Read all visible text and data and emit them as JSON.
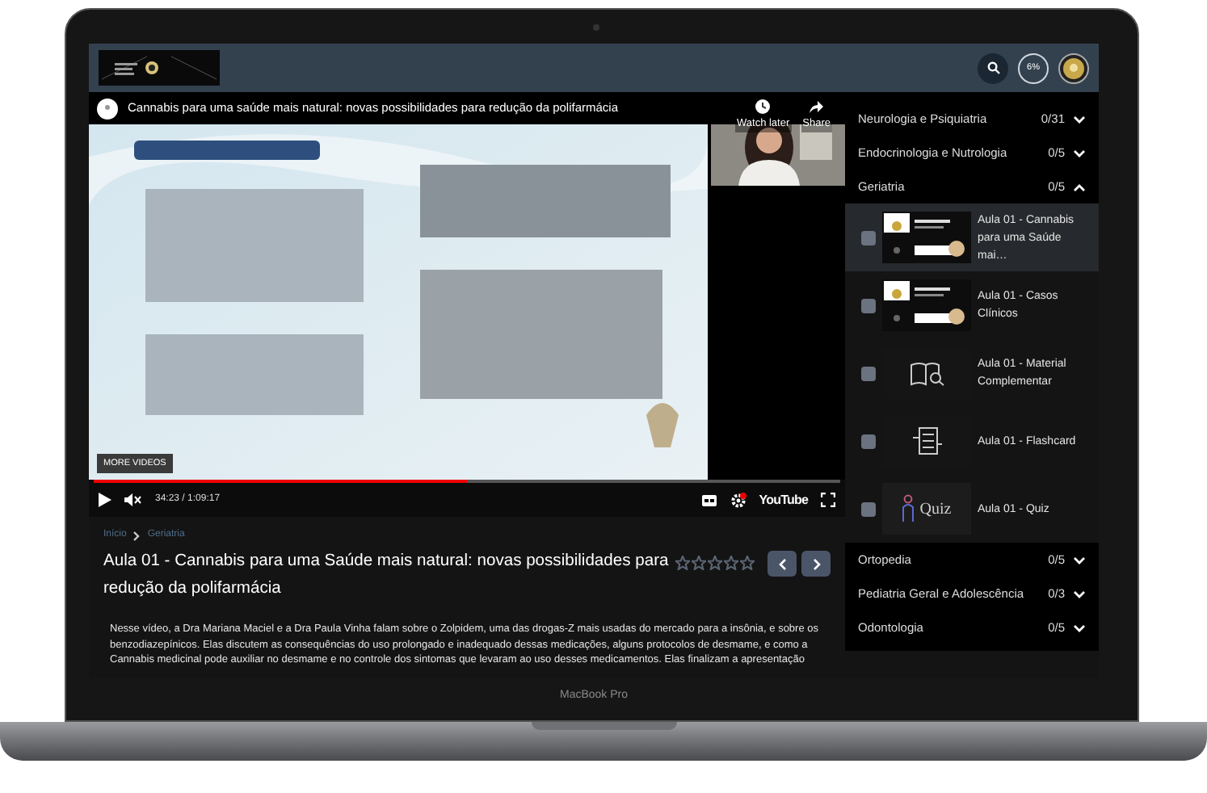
{
  "header": {
    "progress": "6%"
  },
  "video": {
    "title": "Cannabis para uma saúde mais natural: novas possibilidades para redução da polifarmácia",
    "actions": [
      {
        "kind": "clock",
        "label": "Watch later"
      },
      {
        "kind": "share",
        "label": "Share"
      }
    ],
    "more_videos": "MORE VIDEOS",
    "time": "34:23 / 1:09:17",
    "level": 0.5,
    "brand": "YouTube"
  },
  "lesson": {
    "breadcrumb": [
      "Início",
      "Geriatria"
    ],
    "title": "Aula 01 - Cannabis para uma Saúde mais natural: novas possibilidades para redução da polifarmácia",
    "stars": 0,
    "description": "Nesse vídeo, a Dra Mariana Maciel e a Dra Paula Vinha falam sobre o Zolpidem, uma das drogas-Z mais usadas do mercado para a insônia, e sobre os benzodiazepínicos. Elas discutem as consequências do uso prolongado e inadequado dessas medicações, alguns protocolos de desmame, e como a Cannabis medicinal pode auxiliar no desmame e no controle dos sintomas que levaram ao uso desses medicamentos. Elas finalizam a apresentação"
  },
  "sidebar": {
    "modules": [
      {
        "name": "Neurologia e Psiquiatria",
        "count": "0/31",
        "expanded": false
      },
      {
        "name": "Endocrinologia e Nutrologia",
        "count": "0/5",
        "expanded": false
      },
      {
        "name": "Geriatria",
        "count": "0/5",
        "expanded": true,
        "lessons": [
          {
            "title": "Aula 01 - Cannabis para uma Saúde mai…",
            "kind": "slide",
            "selected": true,
            "checked": false
          },
          {
            "title": "Aula 01 - Casos Clínicos",
            "kind": "slide",
            "selected": false,
            "checked": false
          },
          {
            "title": "Aula 01 - Material Complementar",
            "kind": "book",
            "selected": false,
            "checked": false
          },
          {
            "title": "Aula 01 - Flashcard",
            "kind": "document",
            "selected": false,
            "checked": false
          },
          {
            "title": "Aula 01 - Quiz",
            "kind": "quiz",
            "thumb_label": "Quiz",
            "selected": false,
            "checked": false
          }
        ]
      },
      {
        "name": "Ortopedia",
        "count": "0/5",
        "expanded": false
      },
      {
        "name": "Pediatria Geral e Adolescência",
        "count": "0/3",
        "expanded": false
      },
      {
        "name": "Odontologia",
        "count": "0/5",
        "expanded": false
      }
    ]
  },
  "device": {
    "label": "MacBook Pro"
  }
}
